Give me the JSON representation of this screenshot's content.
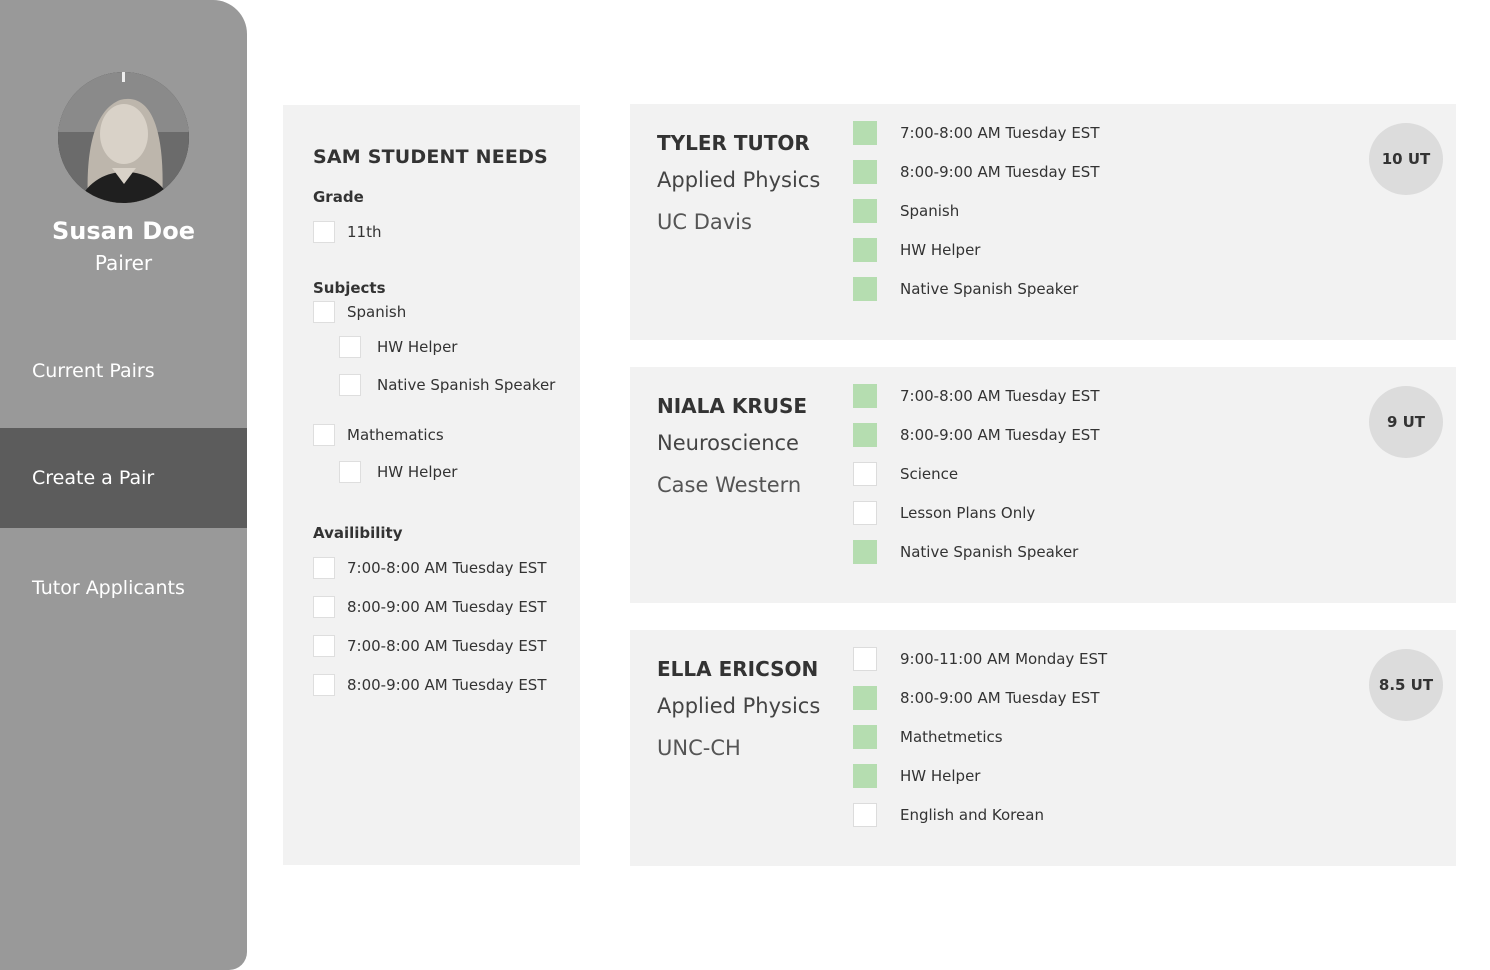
{
  "sidebar": {
    "user": {
      "name": "Susan Doe",
      "role": "Pairer"
    },
    "nav": [
      {
        "label": "Current Pairs",
        "active": false
      },
      {
        "label": "Create a Pair",
        "active": true
      },
      {
        "label": "Tutor Applicants",
        "active": false
      }
    ]
  },
  "student_needs": {
    "title": "SAM STUDENT NEEDS",
    "grade": {
      "label": "Grade",
      "options": [
        {
          "label": "11th",
          "checked": false
        }
      ]
    },
    "subjects": {
      "label": "Subjects",
      "items": [
        {
          "label": "Spanish",
          "checked": false,
          "subitems": [
            {
              "label": "HW Helper",
              "checked": false
            },
            {
              "label": "Native Spanish Speaker",
              "checked": false
            }
          ]
        },
        {
          "label": "Mathematics",
          "checked": false,
          "subitems": [
            {
              "label": "HW Helper",
              "checked": false
            }
          ]
        }
      ]
    },
    "availability": {
      "label": "Availibility",
      "options": [
        {
          "label": "7:00-8:00 AM Tuesday EST",
          "checked": false
        },
        {
          "label": "8:00-9:00 AM Tuesday EST",
          "checked": false
        },
        {
          "label": "7:00-8:00 AM Tuesday EST",
          "checked": false
        },
        {
          "label": "8:00-9:00 AM Tuesday EST",
          "checked": false
        }
      ]
    }
  },
  "tutors": [
    {
      "name": "TYLER TUTOR",
      "field": "Applied Physics",
      "school": "UC Davis",
      "score": "10 UT",
      "attributes": [
        {
          "label": "7:00-8:00 AM Tuesday EST",
          "match": true
        },
        {
          "label": "8:00-9:00 AM Tuesday EST",
          "match": true
        },
        {
          "label": "Spanish",
          "match": true
        },
        {
          "label": "HW Helper",
          "match": true
        },
        {
          "label": "Native Spanish Speaker",
          "match": true
        }
      ]
    },
    {
      "name": "NIALA KRUSE",
      "field": "Neuroscience",
      "school": "Case Western",
      "score": "9 UT",
      "attributes": [
        {
          "label": "7:00-8:00 AM Tuesday EST",
          "match": true
        },
        {
          "label": "8:00-9:00 AM Tuesday EST",
          "match": true
        },
        {
          "label": "Science",
          "match": false
        },
        {
          "label": "Lesson Plans Only",
          "match": false
        },
        {
          "label": "Native Spanish Speaker",
          "match": true
        }
      ]
    },
    {
      "name": "ELLA ERICSON",
      "field": "Applied Physics",
      "school": "UNC-CH",
      "score": "8.5 UT",
      "attributes": [
        {
          "label": "9:00-11:00 AM Monday EST",
          "match": false
        },
        {
          "label": "8:00-9:00 AM Tuesday EST",
          "match": true
        },
        {
          "label": "Mathetmetics",
          "match": true
        },
        {
          "label": "HW Helper",
          "match": true
        },
        {
          "label": "English and Korean",
          "match": false
        }
      ]
    }
  ],
  "colors": {
    "sidebar": "#999999",
    "active_nav": "#5c5c5c",
    "panel": "#f2f2f2",
    "match": "#b5ddb0",
    "score_badge": "#dcdcdc"
  }
}
